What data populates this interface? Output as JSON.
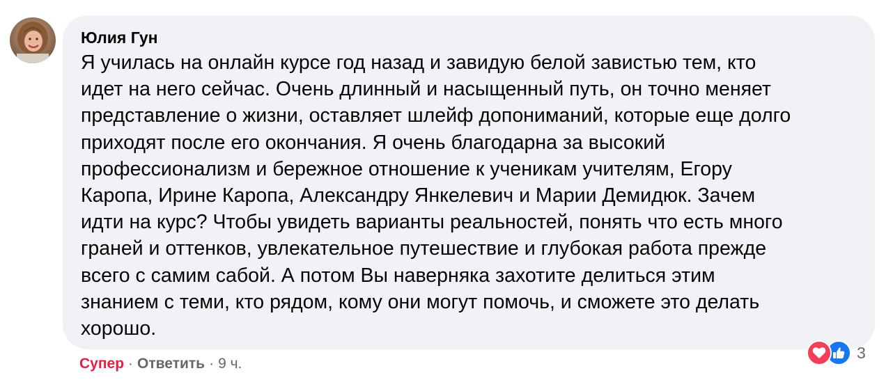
{
  "comment": {
    "author": "Юлия Гун",
    "text": "Я училась на онлайн курсе год назад и завидую белой завистью тем, кто\nидет на него сейчас. Очень длинный и насыщенный путь, он точно меняет\nпредставление о жизни, оставляет шлейф допониманий, которые еще долго\nприходят после его окончания. Я очень благодарна за высокий\nпрофессионализм и бережное отношение к ученикам учителям, Егору\nКаропа, Ирине Каропа, Александру Янкелевич и Марии Демидюк. Зачем\nидти на курс? Чтобы увидеть варианты реальностей, понять что есть много\nграней и оттенков, увлекательное путешествие и глубокая работа прежде\nвсего с самим сабой. А потом Вы наверняка захотите делиться этим\nзнанием с теми, кто рядом, кому они могут помочь, и сможете это делать\nхорошо."
  },
  "actions": {
    "reaction_label": "Супер",
    "separator": "·",
    "reply_label": "Ответить",
    "time": "9 ч."
  },
  "reactions": {
    "icons": [
      "love-icon",
      "like-icon"
    ],
    "count": "3"
  },
  "colors": {
    "bubble_bg": "#f0f2f5",
    "reaction_text": "#e41e3f",
    "meta_text": "#65676b",
    "love": "#f33e58",
    "like": "#1877f2"
  }
}
